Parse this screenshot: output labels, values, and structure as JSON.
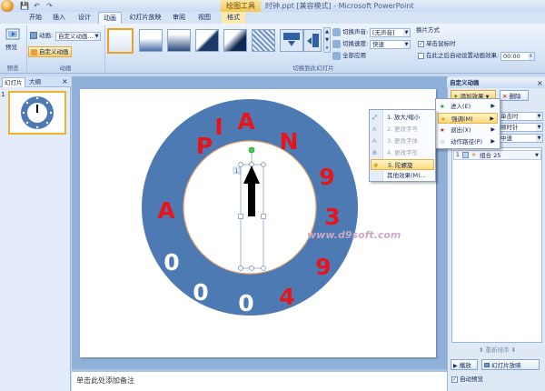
{
  "titlebar": {
    "context_tool": "绘图工具",
    "window_title": "时钟.ppt [兼容模式] - Microsoft PowerPoint",
    "qat": [
      "💾",
      "↶",
      "↷"
    ]
  },
  "tabs": [
    {
      "label": "开始"
    },
    {
      "label": "插入"
    },
    {
      "label": "设计"
    },
    {
      "label": "动画"
    },
    {
      "label": "幻灯片放映"
    },
    {
      "label": "审阅"
    },
    {
      "label": "视图"
    },
    {
      "label": "格式"
    }
  ],
  "ribbon": {
    "preview_label": "预览",
    "preview_group": "预览",
    "animate_label": "动画:",
    "animate_value": "自定义动画...",
    "custom_anim_button": "自定义动画",
    "anim_group": "动画",
    "transition_sound_label": "切换声音:",
    "transition_sound_value": "[无声音]",
    "transition_speed_label": "切换速度:",
    "transition_speed_value": "快速",
    "apply_all": "全部应用",
    "advance_heading": "换片方式",
    "on_click": "单击鼠标时",
    "after_time": "在此之后自动设置动画效果:",
    "after_time_value": "00:00",
    "transition_group": "切换到此幻灯片"
  },
  "left_pane": {
    "tab_slides": "幻灯片",
    "tab_outline": "大纲",
    "slide_number": "1"
  },
  "slide": {
    "outer_letters": [
      "P",
      "I",
      "A",
      "N",
      "9",
      "3",
      "9",
      "4",
      "0",
      "0",
      "0",
      "A"
    ],
    "watermark": "www.d9soft.com",
    "shape_tag": "1",
    "ring_color": "#4d7ab3",
    "letter_color": "#e8141c"
  },
  "notes": {
    "placeholder": "单击此处添加备注"
  },
  "right_pane": {
    "title": "自定义动画",
    "add_effect": "添加效果",
    "remove": "删除",
    "start_value": "单击时",
    "direction_value": "顺时针",
    "speed_value": "中速",
    "list_item": "组合 25",
    "list_number": "1",
    "reorder": "重新排序",
    "play": "播放",
    "slideshow": "幻灯片放映",
    "autopreview": "自动预览"
  },
  "add_effect_menu": [
    {
      "label": "进入(E)",
      "highlighted": false
    },
    {
      "label": "强调(M)",
      "highlighted": true
    },
    {
      "label": "退出(X)",
      "highlighted": false
    },
    {
      "label": "动作路径(P)",
      "highlighted": false
    }
  ],
  "emphasis_menu": [
    {
      "num": "1.",
      "label": "放大/缩小",
      "disabled": false
    },
    {
      "num": "2.",
      "label": "更改字号",
      "disabled": true
    },
    {
      "num": "3.",
      "label": "更改字体",
      "disabled": true
    },
    {
      "num": "4.",
      "label": "更改字形",
      "disabled": true
    },
    {
      "num": "5.",
      "label": "陀螺旋",
      "disabled": false
    },
    {
      "num": "",
      "label": "其他效果(M)...",
      "disabled": false
    }
  ]
}
